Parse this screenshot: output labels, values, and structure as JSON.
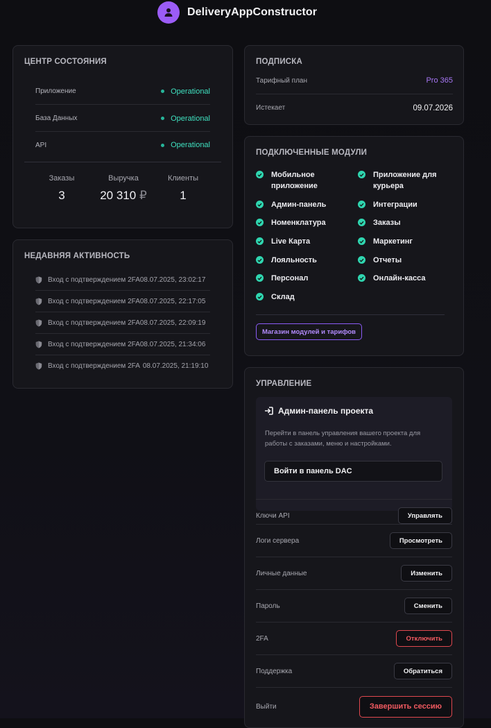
{
  "app": {
    "title": "DeliveryAppConstructor"
  },
  "status_center": {
    "title": "ЦЕНТР СОСТОЯНИЯ",
    "items": [
      {
        "label": "Приложение",
        "status": "Operational"
      },
      {
        "label": "База Данных",
        "status": "Operational"
      },
      {
        "label": "API",
        "status": "Operational"
      }
    ],
    "stats": [
      {
        "label": "Заказы",
        "value": "3"
      },
      {
        "label": "Выручка",
        "value": "20 310",
        "currency": "₽"
      },
      {
        "label": "Клиенты",
        "value": "1"
      }
    ]
  },
  "activity": {
    "title": "НЕДАВНЯЯ АКТИВНОСТЬ",
    "items": [
      {
        "text": "Вход с подтверждением 2FA",
        "time": "08.07.2025, 23:02:17"
      },
      {
        "text": "Вход с подтверждением 2FA",
        "time": "08.07.2025, 22:17:05"
      },
      {
        "text": "Вход с подтверждением 2FA",
        "time": "08.07.2025, 22:09:19"
      },
      {
        "text": "Вход с подтверждением 2FA",
        "time": "08.07.2025, 21:34:06"
      },
      {
        "text": "Вход с подтверждением 2FA",
        "time": "08.07.2025, 21:19:10"
      }
    ]
  },
  "subscription": {
    "title": "ПОДПИСКА",
    "plan_label": "Тарифный план",
    "plan_value": "Pro 365",
    "expires_label": "Истекает",
    "expires_value": "09.07.2026"
  },
  "modules": {
    "title": "ПОДКЛЮЧЕННЫЕ МОДУЛИ",
    "items": [
      "Мобильное приложение",
      "Приложение для курьера",
      "Админ-панель",
      "Интеграции",
      "Номенклатура",
      "Заказы",
      "Live Карта",
      "Маркетинг",
      "Лояльность",
      "Отчеты",
      "Персонал",
      "Онлайн-касса",
      "Склад"
    ],
    "store_button": "Магазин модулей и тарифов"
  },
  "management": {
    "title": "УПРАВЛЕНИЕ",
    "admin_panel": {
      "title": "Админ-панель проекта",
      "description": "Перейти в панель управления вашего проекта для работы с заказами, меню и настройками.",
      "button": "Войти в панель DAC"
    },
    "rows": [
      {
        "label": "Ключи API",
        "button": "Управлять"
      },
      {
        "label": "Логи сервера",
        "button": "Просмотреть"
      },
      {
        "label": "Личные данные",
        "button": "Изменить"
      },
      {
        "label": "Пароль",
        "button": "Сменить"
      },
      {
        "label": "2FA",
        "button": "Отключить"
      },
      {
        "label": "Поддержка",
        "button": "Обратиться"
      },
      {
        "label": "Выйти",
        "button": "Завершить сессию"
      }
    ]
  },
  "colors": {
    "accent": "#9b5cf6",
    "operational": "#3fe0bf",
    "danger": "#f15a60",
    "background": "#0e0e12",
    "card": "#16161b"
  }
}
